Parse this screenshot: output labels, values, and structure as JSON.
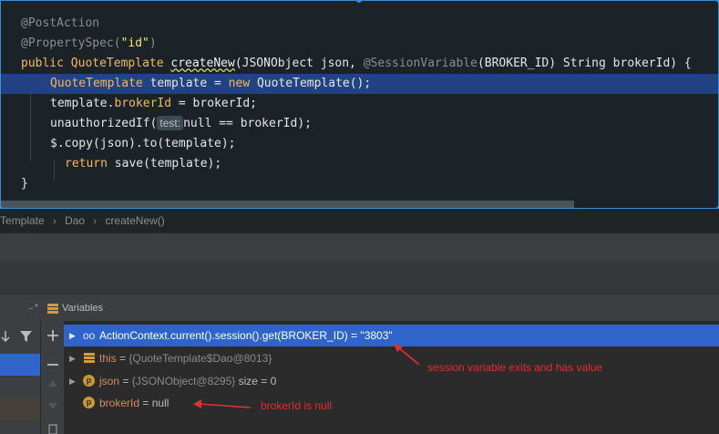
{
  "editor": {
    "lines": {
      "l1": "@PostAction",
      "l2": {
        "a": "@PropertySpec(",
        "s": "\"id\"",
        "b": ")"
      },
      "l3": {
        "kw": "public",
        "cls": "QuoteTemplate",
        "fn": "createNew",
        "p1": "(JSONObject json, ",
        "ann": "@SessionVariable",
        "p2": "(BROKER_ID) String brokerId) {"
      },
      "l4": {
        "cls": "QuoteTemplate",
        "v": " template = ",
        "kw": "new",
        "rest": " QuoteTemplate();"
      },
      "l5": {
        "a": "template.",
        "fld": "brokerId",
        "b": " = brokerId;"
      },
      "l6": {
        "a": "unauthorizedIf(",
        "hint": "test:",
        "b": "null == brokerId);"
      },
      "l7": {
        "a": "$.copy(json).to(template);"
      },
      "l8": {
        "kw": "return",
        "b": " save(template);"
      },
      "l9": "}"
    }
  },
  "breadcrumb": {
    "items": [
      "Template",
      "Dao",
      "createNew()"
    ],
    "sep": "›"
  },
  "panel": {
    "title": "Variables",
    "arrow": "→*"
  },
  "variables": [
    {
      "icon": "watch-icon",
      "text": "ActionContext.current().session().get(BROKER_ID) = \"3803\""
    },
    {
      "icon": "list-icon",
      "name": "this",
      "eq": " = ",
      "val": "{QuoteTemplate$Dao@8013}"
    },
    {
      "icon": "p-icon",
      "name": "json",
      "eq": " = ",
      "val": "{JSONObject@8295}",
      "extra": " size = 0"
    },
    {
      "icon": "p-icon",
      "name": "brokerId",
      "eq": " = ",
      "val": "null"
    }
  ],
  "notes": {
    "session": "session variable exits and has value",
    "broker": "brokerId is null"
  },
  "colors": {
    "accent": "#3d8fd1",
    "selection": "#2f65ca",
    "annotation": "#e03030"
  }
}
